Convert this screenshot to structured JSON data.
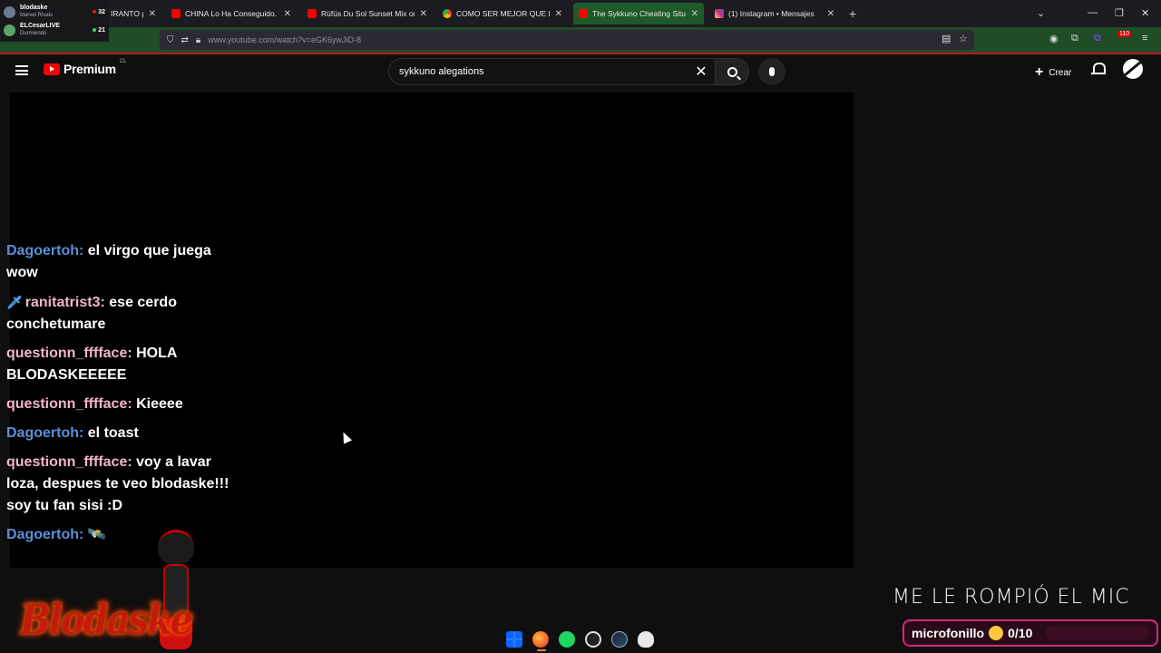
{
  "browser": {
    "follows": [
      {
        "name": "blodaske",
        "sub": "Marvel Rivals",
        "count": "32"
      },
      {
        "name": "ELCesarLIVE",
        "sub": "Durmiendo",
        "count": "21"
      }
    ],
    "tabs": [
      {
        "label": "IRANTO po",
        "favicon": "youtube",
        "active": false
      },
      {
        "label": "CHINA Lo Ha Conseguido. - Yo",
        "favicon": "youtube",
        "active": false
      },
      {
        "label": "Rüfüs Du Sol Sunset Mix on the",
        "favicon": "youtube",
        "active": false
      },
      {
        "label": "COMO SER MEJOR QUE NETAN",
        "favicon": "chrome",
        "active": false
      },
      {
        "label": "The Sykkuno Cheating Situatio",
        "favicon": "youtube",
        "active": true
      },
      {
        "label": "(1) Instagram • Mensajes",
        "favicon": "instagram",
        "active": false
      }
    ],
    "url": "www.youtube.com/watch?v=eGK6ywJiD-8",
    "badge_count": "110"
  },
  "youtube": {
    "brand": "Premium",
    "region": "CL",
    "search_value": "sykkuno alegations",
    "create_label": "Crear"
  },
  "chat": [
    {
      "user": "Dagoertoh:",
      "text": "el virgo que juega wow",
      "color": "blue",
      "badge": false
    },
    {
      "user": "ranitatrist3:",
      "text": "ese cerdo conchetumare",
      "color": "pink",
      "badge": true
    },
    {
      "user": "questionn_fffface:",
      "text": "HOLA BLODASKEEEEE",
      "color": "pink",
      "badge": false
    },
    {
      "user": "questionn_fffface:",
      "text": "Kieeee",
      "color": "pink",
      "badge": false
    },
    {
      "user": "Dagoertoh:",
      "text": "el toast",
      "color": "blue",
      "badge": false
    },
    {
      "user": "questionn_fffface:",
      "text": "voy a lavar loza, despues te veo blodaske!!! soy tu fan sisi :D",
      "color": "pink",
      "badge": false
    },
    {
      "user": "Dagoertoh:",
      "text": "🛰️",
      "color": "blue",
      "badge": false
    }
  ],
  "overlay": {
    "logo_text": "Blodaske",
    "banner": "ME LE ROMPIÓ EL MIC",
    "counter_label": "microfonillo",
    "counter_value": "0/10",
    "counter_progress": 0
  },
  "colors": {
    "active_tab": "#1c5a29",
    "address_bar": "#1f4d26",
    "chat_user_blue": "#5b8fd8",
    "chat_user_pink": "#f2b6c6",
    "counter_border": "#d6297a"
  }
}
